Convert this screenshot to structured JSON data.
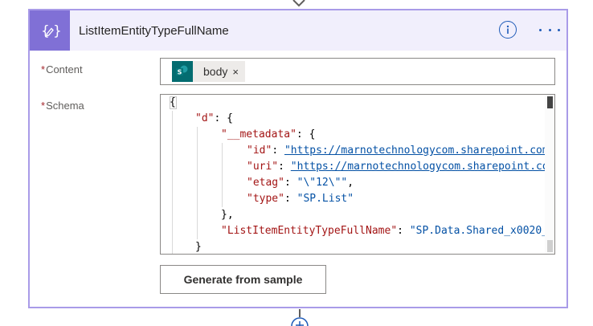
{
  "card": {
    "title": "ListItemEntityTypeFullName",
    "icon": "data-operation-icon",
    "info_icon": "info-icon",
    "more_icon": "more-options-icon",
    "accent_color": "#8070d6",
    "header_color": "#f1effc",
    "border_color": "#a99be8"
  },
  "fields": {
    "required_marker": "*",
    "content": {
      "label": "Content",
      "token": {
        "label": "body",
        "remove": "×",
        "icon": "sharepoint-icon",
        "icon_color": "#036c70"
      }
    },
    "schema": {
      "label": "Schema",
      "lines": [
        {
          "p0": "{"
        },
        {
          "k": "\"d\"",
          "p": ": {"
        },
        {
          "k": "\"__metadata\"",
          "p": ": {"
        },
        {
          "k": "\"id\"",
          "p": ": ",
          "u": "\"https://marnotechnologycom.sharepoint.com"
        },
        {
          "k": "\"uri\"",
          "p": ": ",
          "u": "\"https://marnotechnologycom.sharepoint.co"
        },
        {
          "k": "\"etag\"",
          "p": ": ",
          "s": "\"\\\"12\\\"\"",
          "p2": ","
        },
        {
          "k": "\"type\"",
          "p": ": ",
          "s": "\"SP.List\""
        },
        {
          "p0": "},"
        },
        {
          "k": "\"ListItemEntityTypeFullName\"",
          "p": ": ",
          "s": "\"SP.Data.Shared_x0020_"
        },
        {
          "p0": "}"
        }
      ]
    }
  },
  "buttons": {
    "generate": "Generate from sample"
  },
  "connector": {
    "add_icon": "plus-icon"
  }
}
